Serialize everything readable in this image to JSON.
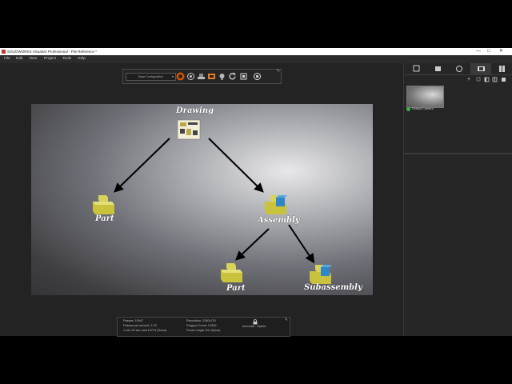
{
  "window": {
    "title": "SOLIDWORKS Visualize Professional - File Reference *"
  },
  "menu": [
    "File",
    "Edit",
    "View",
    "Project",
    "Tools",
    "Help"
  ],
  "toolbar": {
    "configuration": "Base Configuration"
  },
  "diagram": {
    "nodes": {
      "drawing": "Drawing",
      "part1": "Part",
      "assembly": "Assembly",
      "part2": "Part",
      "subassembly": "Subassembly"
    },
    "colors": {
      "part": "#c9c23c",
      "subpart": "#2f86c8",
      "arrow": "#000000"
    }
  },
  "stats": {
    "passes": "Passes: 10947",
    "passes_per_second": "Passes per second: 2.23",
    "time": "1 min 33 sec until 10770 (Good)",
    "resolution": "Resolution: 1280x720",
    "polygon_count": "Polygon Count: 21692",
    "focal_length": "Focal Length: 54.15(mm)",
    "mode": "Accurate - Hybrid"
  },
  "right_panel": {
    "camera_label": "Default Camera"
  },
  "colors": {
    "app_bg": "#232323",
    "panel_bg": "#262626",
    "accent_ok": "#3bb54a"
  }
}
